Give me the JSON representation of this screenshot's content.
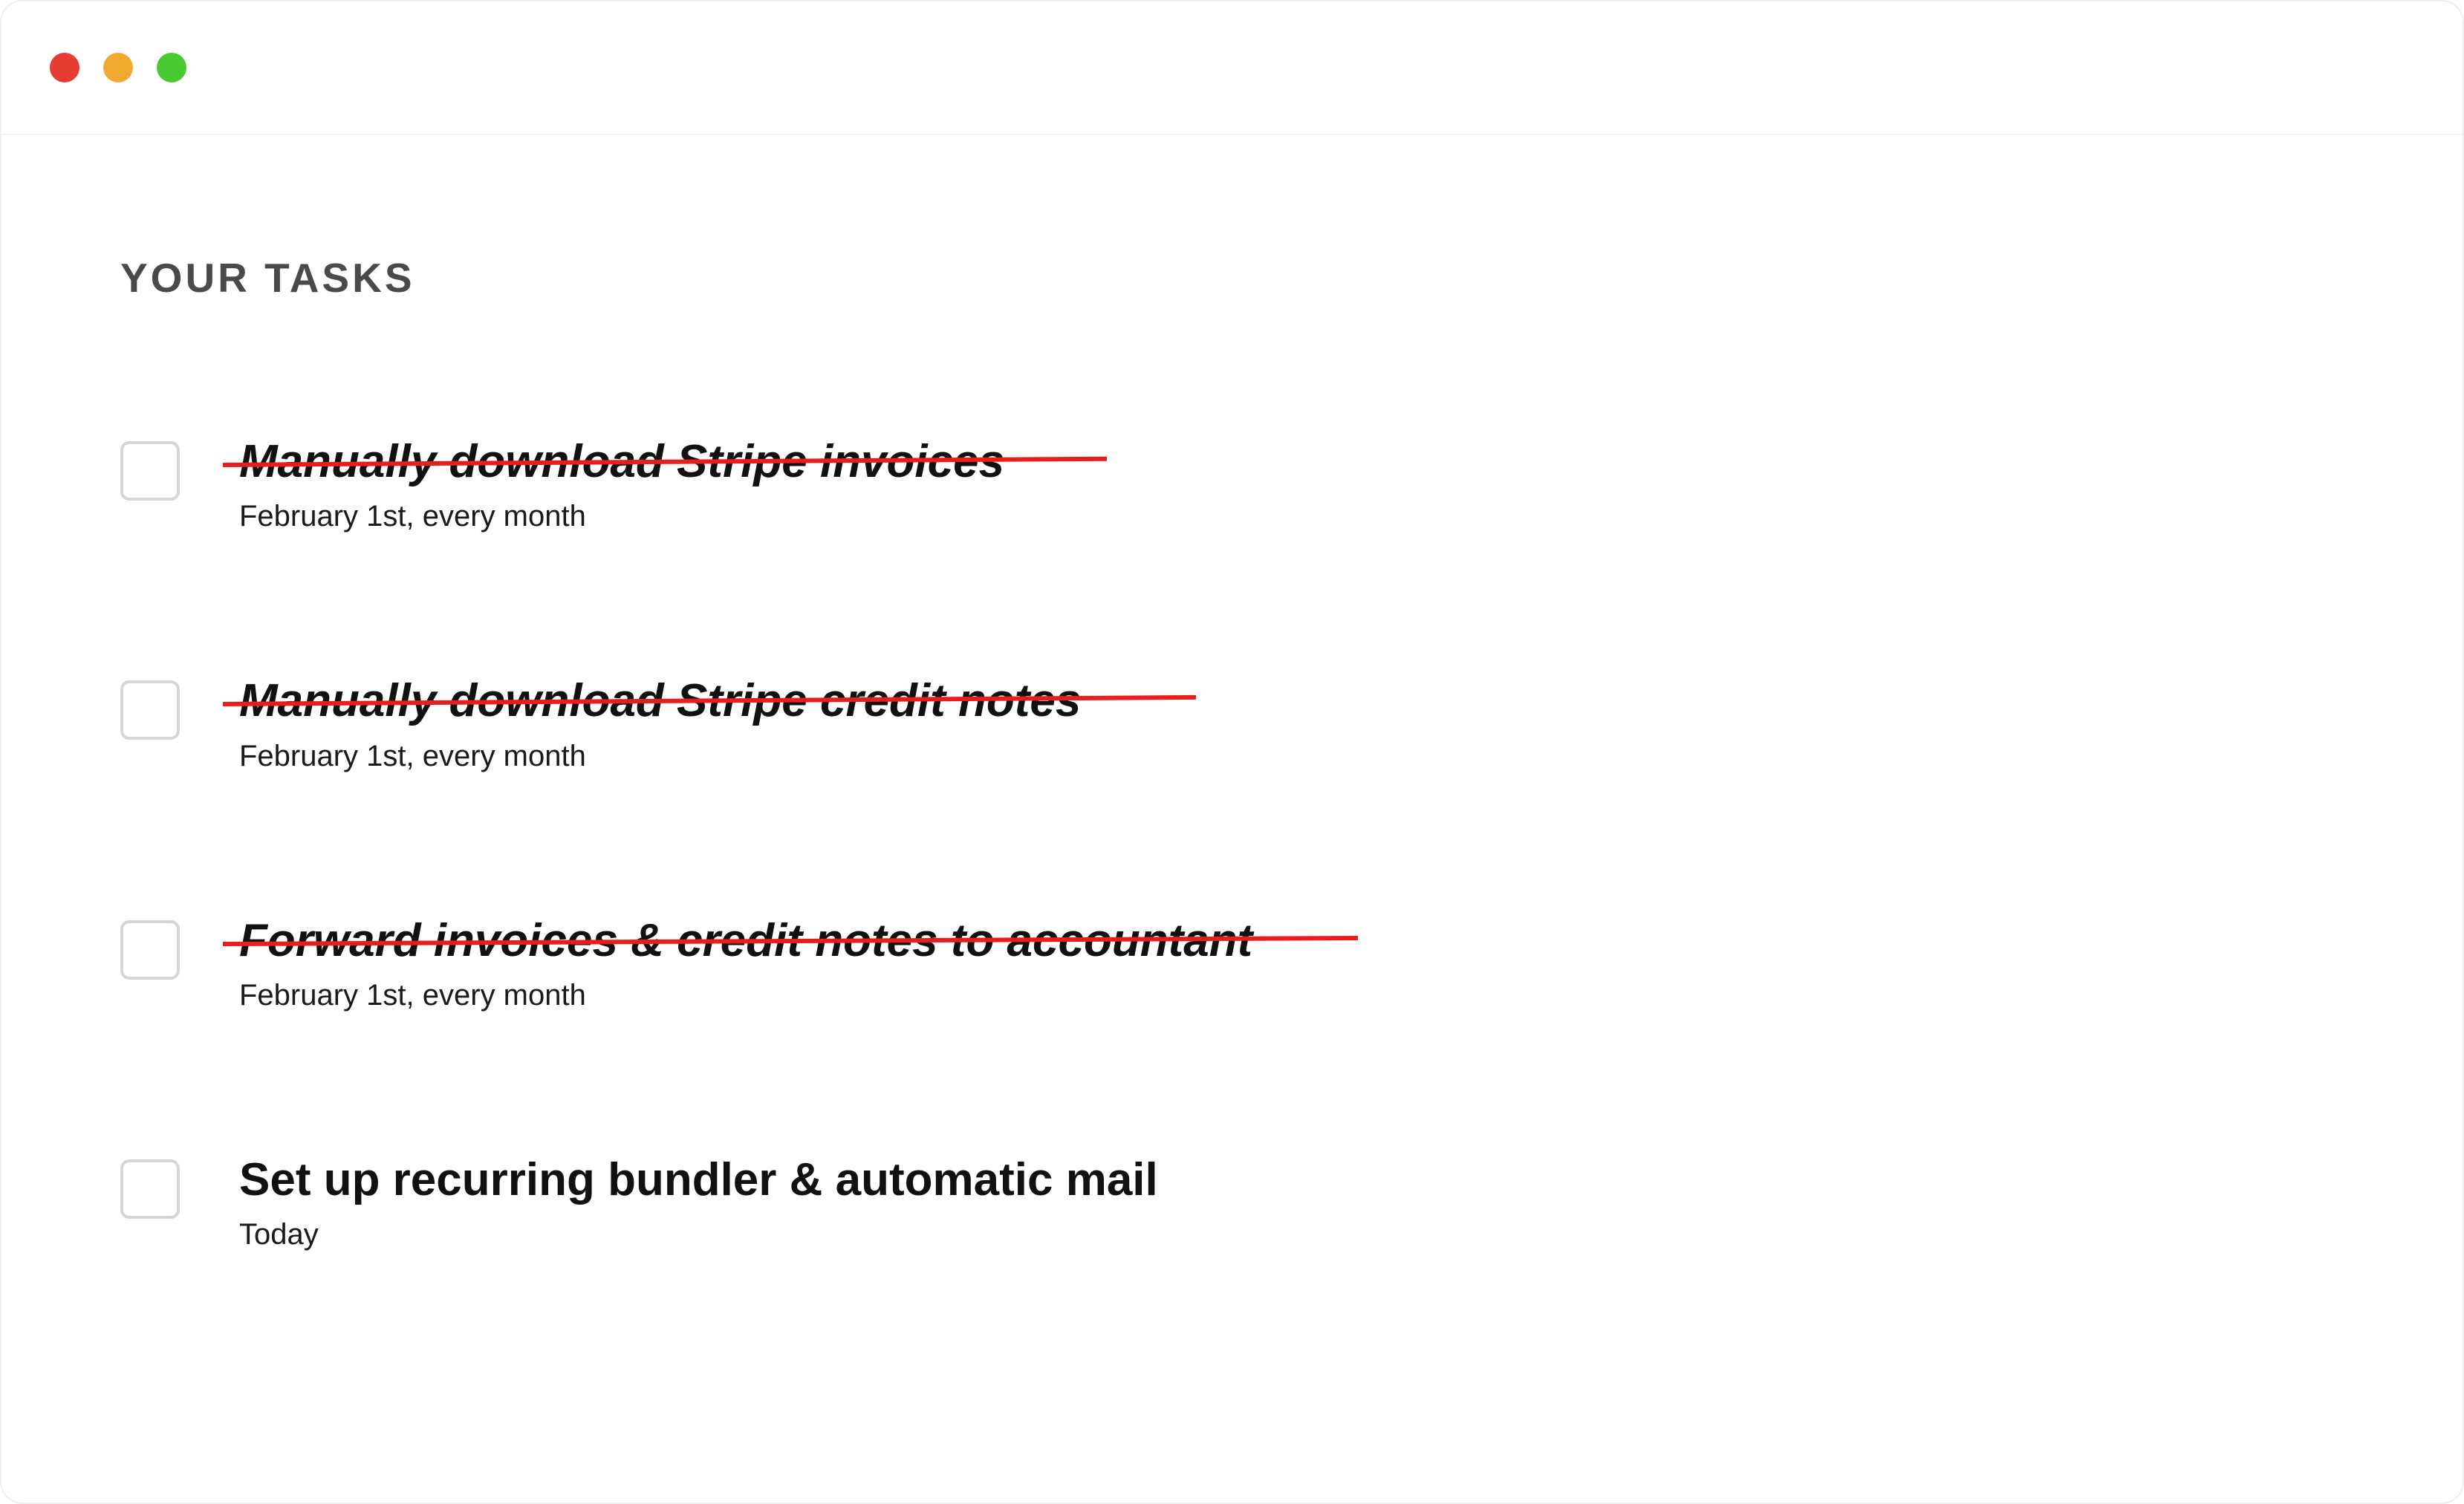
{
  "heading": "YOUR TASKS",
  "tasks": [
    {
      "title": "Manually download Stripe invoices",
      "sub": "February 1st, every month",
      "slashed": true,
      "slashWidth": "1190px",
      "slashRotate": "-0.4deg"
    },
    {
      "title": "Manually download Stripe credit notes",
      "sub": "February 1st, every month",
      "slashed": true,
      "slashWidth": "1310px",
      "slashRotate": "-0.4deg"
    },
    {
      "title": "Forward invoices & credit notes to accountant",
      "sub": "February 1st, every month",
      "slashed": true,
      "slashWidth": "1528px",
      "slashRotate": "-0.3deg"
    },
    {
      "title": "Set up recurring bundler & automatic mail",
      "sub": "Today",
      "slashed": false
    }
  ]
}
